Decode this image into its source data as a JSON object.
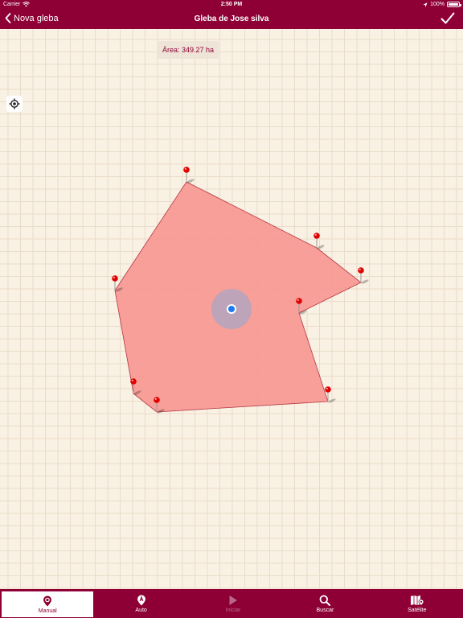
{
  "status_bar": {
    "carrier": "Carrier",
    "time": "2:50 PM",
    "battery": "100%"
  },
  "nav": {
    "back_label": "Nova gleba",
    "title": "Gleba de Jose silva"
  },
  "map": {
    "area_label": "Área: 349.27 ha"
  },
  "tabs": [
    {
      "label": "Manual",
      "icon": "pin-icon",
      "state": "active"
    },
    {
      "label": "Auto",
      "icon": "auto-pin-icon",
      "state": "normal"
    },
    {
      "label": "Iniciar",
      "icon": "play-icon",
      "state": "disabled"
    },
    {
      "label": "Buscar",
      "icon": "search-icon",
      "state": "normal"
    },
    {
      "label": "Satélite",
      "icon": "satellite-map-icon",
      "state": "normal"
    }
  ],
  "colors": {
    "brand": "#8e0035",
    "polygon_fill": "#f79a94",
    "pin": "#e00000",
    "user_location": "#1a7cf0"
  }
}
